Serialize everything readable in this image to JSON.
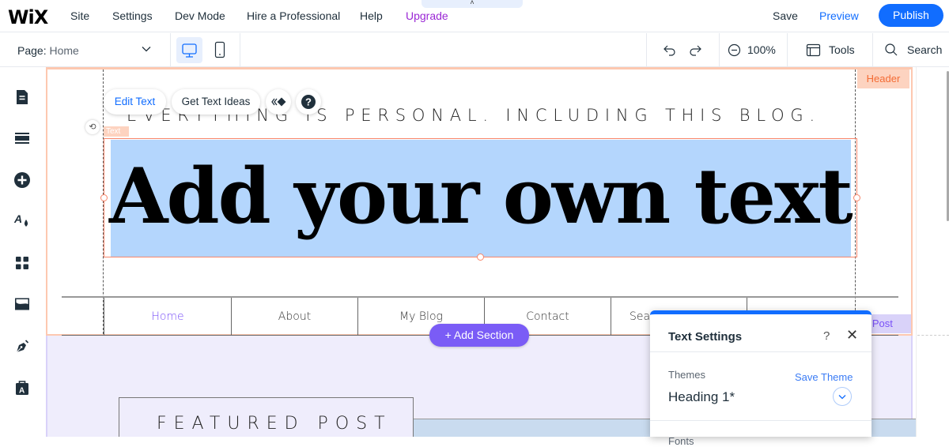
{
  "topbar": {
    "logo": "WiX",
    "menu": [
      {
        "label": "Site"
      },
      {
        "label": "Settings"
      },
      {
        "label": "Dev Mode"
      },
      {
        "label": "Hire a Professional"
      },
      {
        "label": "Help"
      },
      {
        "label": "Upgrade"
      }
    ],
    "collapse_glyph": "˄",
    "save_label": "Save",
    "preview_label": "Preview",
    "publish_label": "Publish"
  },
  "toolbar": {
    "page_label": "Page:",
    "page_value": "Home",
    "zoom_level": "100%",
    "tools_label": "Tools",
    "search_label": "Search"
  },
  "leftrail": {
    "icons": [
      "pages-icon",
      "sections-icon",
      "add-elements-icon",
      "theme-design-icon",
      "apps-icon",
      "media-icon",
      "blog-pen-icon",
      "app-market-icon"
    ]
  },
  "canvas": {
    "header_tag": "Header",
    "tagline": "EVERYTHING IS PERSONAL. INCLUDING THIS BLOG.",
    "text_label": "Text",
    "headline": "Add your own text",
    "floating_toolbar": {
      "edit_text": "Edit Text",
      "get_text_ideas": "Get Text Ideas"
    },
    "nav": [
      {
        "label": "Home",
        "active": true
      },
      {
        "label": "About"
      },
      {
        "label": "My Blog"
      },
      {
        "label": "Contact"
      },
      {
        "label": "Search"
      }
    ],
    "post_tag": "g Post",
    "featured_title": "FEATURED POST",
    "add_section": "+ Add Section"
  },
  "panel": {
    "title": "Text Settings",
    "help": "?",
    "close": "✕",
    "themes_label": "Themes",
    "save_theme": "Save Theme",
    "theme_value": "Heading 1*",
    "fonts_label": "Fonts"
  },
  "colors": {
    "accent_blue": "#116dff",
    "upgrade_purple": "#9a27d5",
    "header_orange": "#f46c35",
    "section_purple": "#7a51f8",
    "selection_blue": "#b4d6fd"
  }
}
